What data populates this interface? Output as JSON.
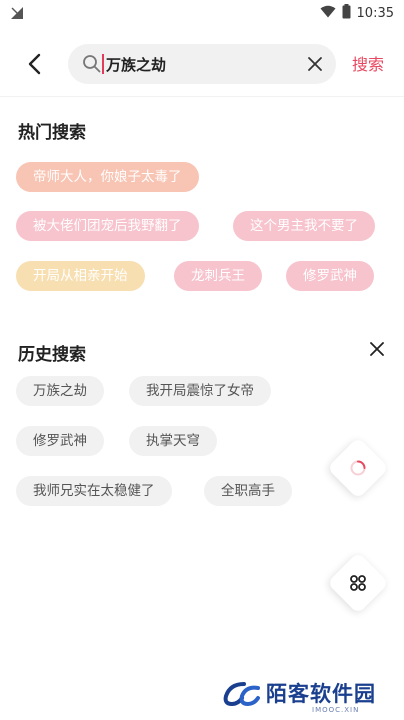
{
  "status_bar": {
    "time": "10:35"
  },
  "search": {
    "value": "万族之劫",
    "submit_label": "搜索"
  },
  "hot": {
    "title": "热门搜索",
    "tags": [
      "帝师大人，你娘子太毒了",
      "被大佬们团宠后我野翻了",
      "这个男主我不要了",
      "开局从相亲开始",
      "龙刺兵王",
      "修罗武神"
    ],
    "colors": {
      "peach": "#f8c4b3",
      "pink": "#f7c3cd",
      "yellow": "#f8dfb1"
    }
  },
  "history": {
    "title": "历史搜索",
    "tags": [
      "万族之劫",
      "我开局震惊了女帝",
      "修罗武神",
      "执掌天穹",
      "我师兄实在太稳健了",
      "全职高手"
    ]
  },
  "accent_color": "#e8475f",
  "watermark": {
    "name": "陌客软件园",
    "domain": "IMOOC.XIN"
  },
  "icons": [
    "signal-icon",
    "wifi-icon",
    "battery-icon",
    "back-arrow-icon",
    "search-icon",
    "clear-icon",
    "close-icon",
    "loading-icon",
    "apps-grid-icon",
    "watermark-logo-icon"
  ]
}
